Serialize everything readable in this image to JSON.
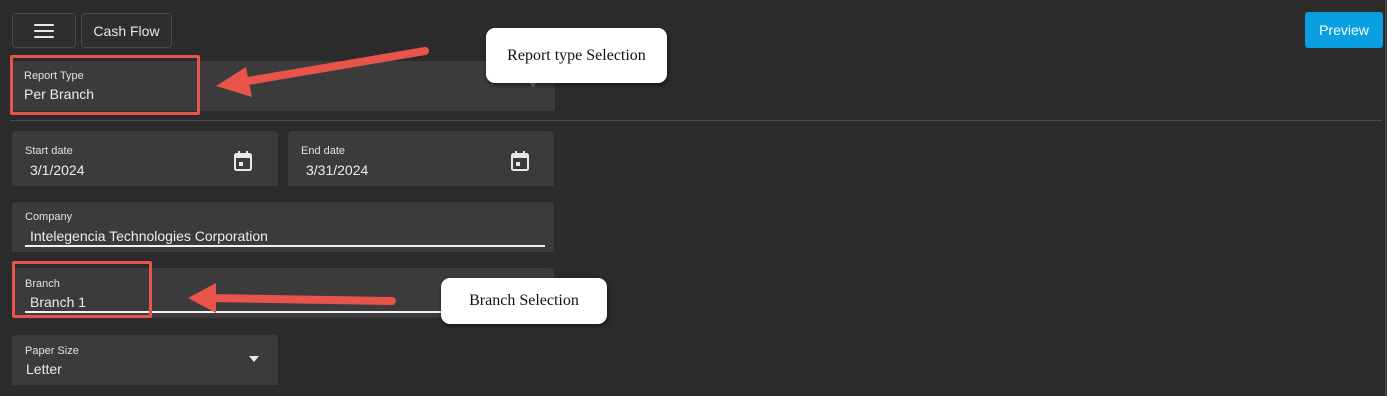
{
  "toolbar": {
    "menu_icon": "hamburger-menu-icon",
    "report_title": "Cash Flow",
    "preview_label": "Preview",
    "preview_color": "#0a9fe0"
  },
  "form": {
    "report_type": {
      "label": "Report Type",
      "value": "Per Branch"
    },
    "start_date": {
      "label": "Start date",
      "value": "3/1/2024",
      "icon": "calendar-icon"
    },
    "end_date": {
      "label": "End date",
      "value": "3/31/2024",
      "icon": "calendar-icon"
    },
    "company": {
      "label": "Company",
      "value": "Intelegencia Technologies Corporation"
    },
    "branch": {
      "label": "Branch",
      "value": "Branch 1"
    },
    "paper_size": {
      "label": "Paper Size",
      "value": "Letter",
      "icon": "dropdown-arrow-icon"
    }
  },
  "annotations": {
    "report_type_callout": "Report type Selection",
    "branch_callout": "Branch Selection",
    "highlight_color": "#e8534a"
  }
}
